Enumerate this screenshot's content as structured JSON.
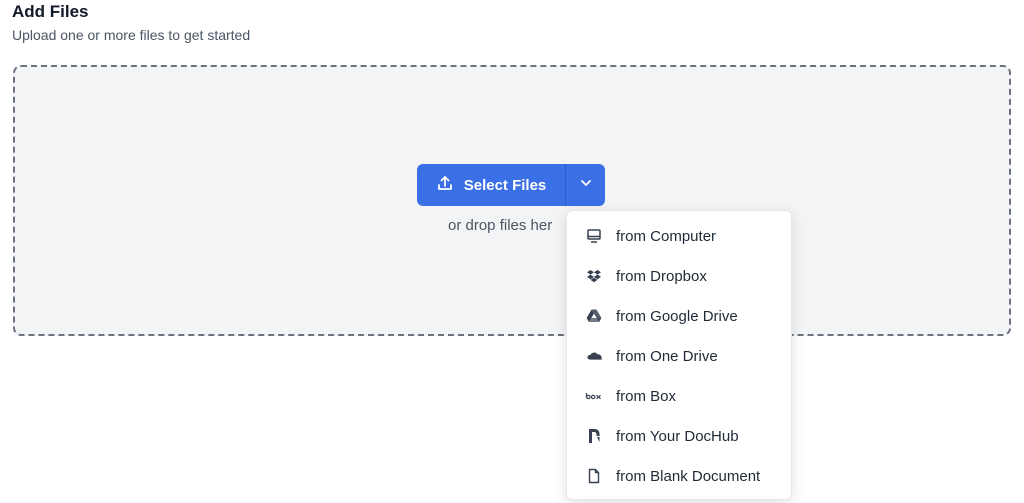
{
  "header": {
    "title": "Add Files",
    "subtitle": "Upload one or more files to get started"
  },
  "upload": {
    "select_label": "Select Files",
    "drop_hint": "or drop files her"
  },
  "menu": {
    "items": [
      {
        "label": "from Computer",
        "icon": "monitor-icon"
      },
      {
        "label": "from Dropbox",
        "icon": "dropbox-icon"
      },
      {
        "label": "from Google Drive",
        "icon": "google-drive-icon"
      },
      {
        "label": "from One Drive",
        "icon": "onedrive-icon"
      },
      {
        "label": "from Box",
        "icon": "box-icon"
      },
      {
        "label": "from Your DocHub",
        "icon": "dochub-icon"
      },
      {
        "label": "from Blank Document",
        "icon": "blank-document-icon"
      }
    ]
  },
  "colors": {
    "primary": "#3b6fe6",
    "dropzone_bg": "#f3f4f6"
  }
}
